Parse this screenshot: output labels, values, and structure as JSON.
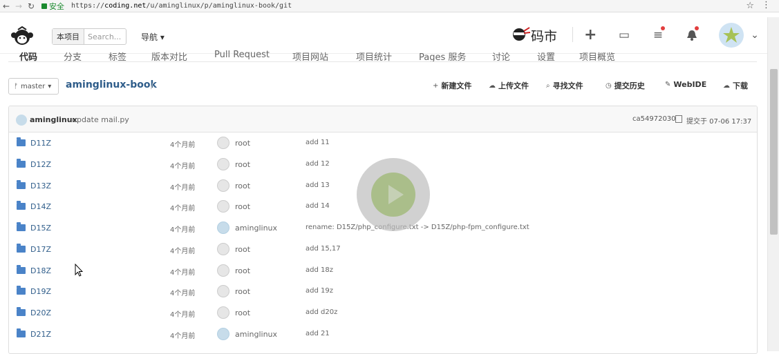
{
  "browser": {
    "back": "←",
    "forward": "→",
    "reload": "↻",
    "secure_label": "安全",
    "url_prefix": "https://",
    "url_host": "coding.net",
    "url_path": "/u/aminglinux/p/aminglinux-book/git",
    "star": "☆",
    "menu": "⋮"
  },
  "topnav": {
    "scope_tag": "本项目",
    "search_placeholder": "Search...",
    "guide_label": "导航",
    "brand_text": "码市",
    "plus": "+",
    "folder_icon": "▭",
    "list_icon": "≡",
    "bell_icon": "🔔",
    "dropdown": "⌄"
  },
  "tabs": [
    "代码",
    "分支",
    "标签",
    "版本对比",
    "Pull Request",
    "项目网站",
    "项目统计",
    "Pages 服务",
    "讨论",
    "设置",
    "项目概览"
  ],
  "repo": {
    "branch": "master",
    "name": "aminglinux-book",
    "slash": "/"
  },
  "toolbar": [
    {
      "icon": "+",
      "label": "新建文件"
    },
    {
      "icon": "☁",
      "label": "上传文件"
    },
    {
      "icon": "⌕",
      "label": "寻找文件"
    },
    {
      "icon": "◷",
      "label": "提交历史"
    },
    {
      "icon": "✎",
      "label": "WebIDE"
    },
    {
      "icon": "☁",
      "label": "下载"
    }
  ],
  "last_commit": {
    "author": "aminglinux",
    "message": "update mail.py",
    "hash": "ca54972030",
    "time": "提交于 07-06 17:37"
  },
  "files": [
    {
      "name": "D11Z",
      "age": "4个月前",
      "user": "root",
      "msg": "add 11"
    },
    {
      "name": "D12Z",
      "age": "4个月前",
      "user": "root",
      "msg": "add 12"
    },
    {
      "name": "D13Z",
      "age": "4个月前",
      "user": "root",
      "msg": "add 13"
    },
    {
      "name": "D14Z",
      "age": "4个月前",
      "user": "root",
      "msg": "add 14"
    },
    {
      "name": "D15Z",
      "age": "4个月前",
      "user": "aminglinux",
      "msg": "rename: D15Z/php_configure.txt -> D15Z/php-fpm_configure.txt"
    },
    {
      "name": "D17Z",
      "age": "4个月前",
      "user": "root",
      "msg": "add 15,17"
    },
    {
      "name": "D18Z",
      "age": "4个月前",
      "user": "root",
      "msg": "add 18z"
    },
    {
      "name": "D19Z",
      "age": "4个月前",
      "user": "root",
      "msg": "add 19z"
    },
    {
      "name": "D20Z",
      "age": "4个月前",
      "user": "root",
      "msg": "add d20z"
    },
    {
      "name": "D21Z",
      "age": "4个月前",
      "user": "aminglinux",
      "msg": "add 21"
    }
  ],
  "colors": {
    "link": "#2f5d8a",
    "folder": "#4a83c8",
    "secure": "#1b8a2f",
    "notify": "#e23e3e"
  }
}
